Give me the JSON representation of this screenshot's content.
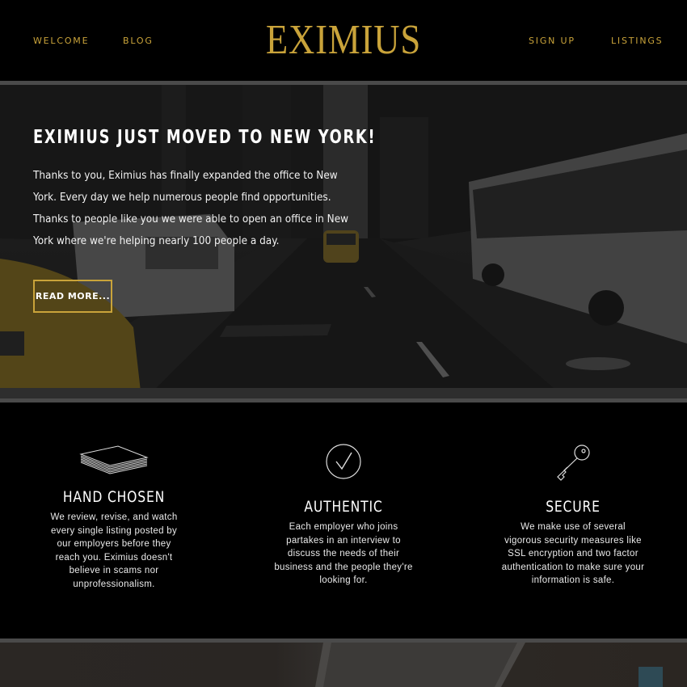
{
  "nav": {
    "welcome": "WELCOME",
    "blog": "BLOG",
    "signup": "SIGN UP",
    "listings": "LISTINGS",
    "logo": "EXIMIUS"
  },
  "hero": {
    "title": "EXIMIUS JUST MOVED TO NEW YORK!",
    "body": "Thanks to you, Eximius has finally expanded the office to New York. Every day we help numerous people find opportunities. Thanks to people like you we were able to open an office in New York where we're helping nearly 100 people a day.",
    "button": "READ MORE..."
  },
  "features": [
    {
      "icon": "paper-stack-icon",
      "title": "HAND CHOSEN",
      "text": "We review, revise, and watch every single listing posted by our employers before they reach you. Eximius doesn't believe in scams nor unprofessionalism."
    },
    {
      "icon": "checkmark-circle-icon",
      "title": "AUTHENTIC",
      "text": "Each employer who joins partakes in an interview to discuss the needs of their business and the people they're looking for."
    },
    {
      "icon": "key-icon",
      "title": "SECURE",
      "text": "We make use of several vigorous security measures like SSL encryption and two factor authentication to make sure your information is safe."
    }
  ],
  "colors": {
    "accent": "#c9a33a",
    "background": "#000000",
    "rule": "#4a4a4a"
  }
}
